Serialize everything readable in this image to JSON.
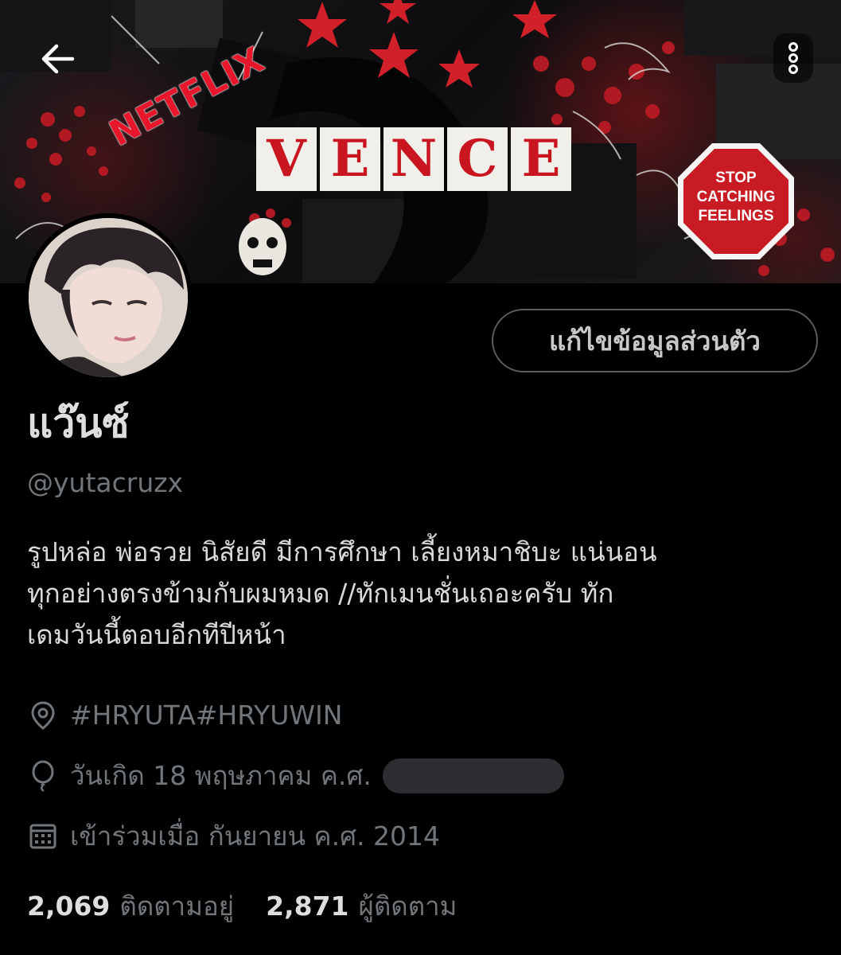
{
  "banner": {
    "netflix_text": "NETFLIX",
    "vence_letters": [
      "V",
      "E",
      "N",
      "C",
      "E"
    ],
    "stop_sign_lines": [
      "STOP",
      "CATCHING",
      "FEELINGS"
    ]
  },
  "header": {
    "back_icon": "arrow-left-icon",
    "more_icon": "more-vertical-icon"
  },
  "profile": {
    "display_name": "แว๊นซ์",
    "handle": "@yutacruzx",
    "edit_button_label": "แก้ไขข้อมูลส่วนตัว",
    "bio_lines": [
      "รูปหล่อ พ่อรวย นิสัยดี มีการศึกษา เลี้ยงหมาชิบะ แน่นอน",
      "ทุกอย่างตรงข้ามกับผมหมด //ทักเมนชั่นเถอะครับ ทัก",
      "เดมวันนี้ตอบอีกทีปีหน้า"
    ],
    "location": "#HRYUTA#HRYUWIN",
    "birthday": "วันเกิด 18 พฤษภาคม ค.ศ.",
    "joined": "เข้าร่วมเมื่อ กันยายน ค.ศ. 2014",
    "following_count": "2,069",
    "following_label": "ติดตามอยู่",
    "followers_count": "2,871",
    "followers_label": "ผู้ติดตาม"
  },
  "colors": {
    "background": "#000000",
    "primary_text": "#d9d9d9",
    "secondary_text": "#71767b",
    "border": "#5a5d62",
    "banner_red": "#c9151f"
  }
}
